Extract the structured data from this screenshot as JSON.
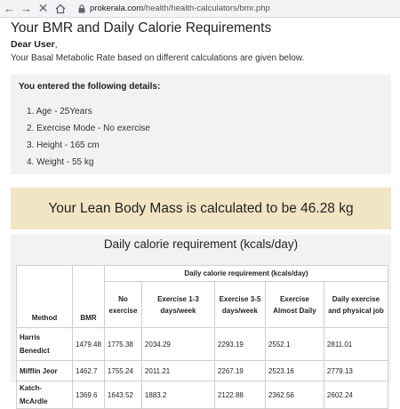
{
  "browser": {
    "url_domain": "prokerala.com",
    "url_path": "/health/health-calculators/bmr.php"
  },
  "page": {
    "title": "Your BMR and Daily Calorie Requirements",
    "greeting_name": "Dear User",
    "greeting_punct": ",",
    "intro": "Your Basal Metabolic Rate based on different calculations are given below."
  },
  "details": {
    "heading": "You entered the following details:",
    "items": [
      "1. Age - 25Years",
      "2. Exercise Mode - No exercise",
      "3. Height - 165 cm",
      "4. Weight - 55 kg"
    ]
  },
  "lean_body_mass": {
    "text": "Your Lean Body Mass is calculated to be 46.28 kg"
  },
  "daily_calorie": {
    "title": "Daily calorie requirement (kcals/day)",
    "group_header": "Daily calorie requirement (kcals/day)",
    "headers": {
      "method": "Method",
      "bmr": "BMR",
      "no_exercise": "No exercise",
      "ex_1_3": "Exercise 1-3 days/week",
      "ex_3_5": "Exercise 3-5 days/week",
      "ex_almost_daily": "Exercise Almost Daily",
      "daily_physical": "Daily exercise and physical job"
    },
    "rows": [
      {
        "method": "Harris Benedict",
        "bmr": "1479.48",
        "no_exercise": "1775.38",
        "ex_1_3": "2034.29",
        "ex_3_5": "2293.19",
        "ex_almost_daily": "2552.1",
        "daily_physical": "2811.01"
      },
      {
        "method": "Mifflin Jeor",
        "bmr": "1462.7",
        "no_exercise": "1755.24",
        "ex_1_3": "2011.21",
        "ex_3_5": "2267.19",
        "ex_almost_daily": "2523.16",
        "daily_physical": "2779.13"
      },
      {
        "method": "Katch-McArdle",
        "bmr": "1369.6",
        "no_exercise": "1643.52",
        "ex_1_3": "1883.2",
        "ex_3_5": "2122.88",
        "ex_almost_daily": "2362.56",
        "daily_physical": "2602.24"
      }
    ]
  }
}
